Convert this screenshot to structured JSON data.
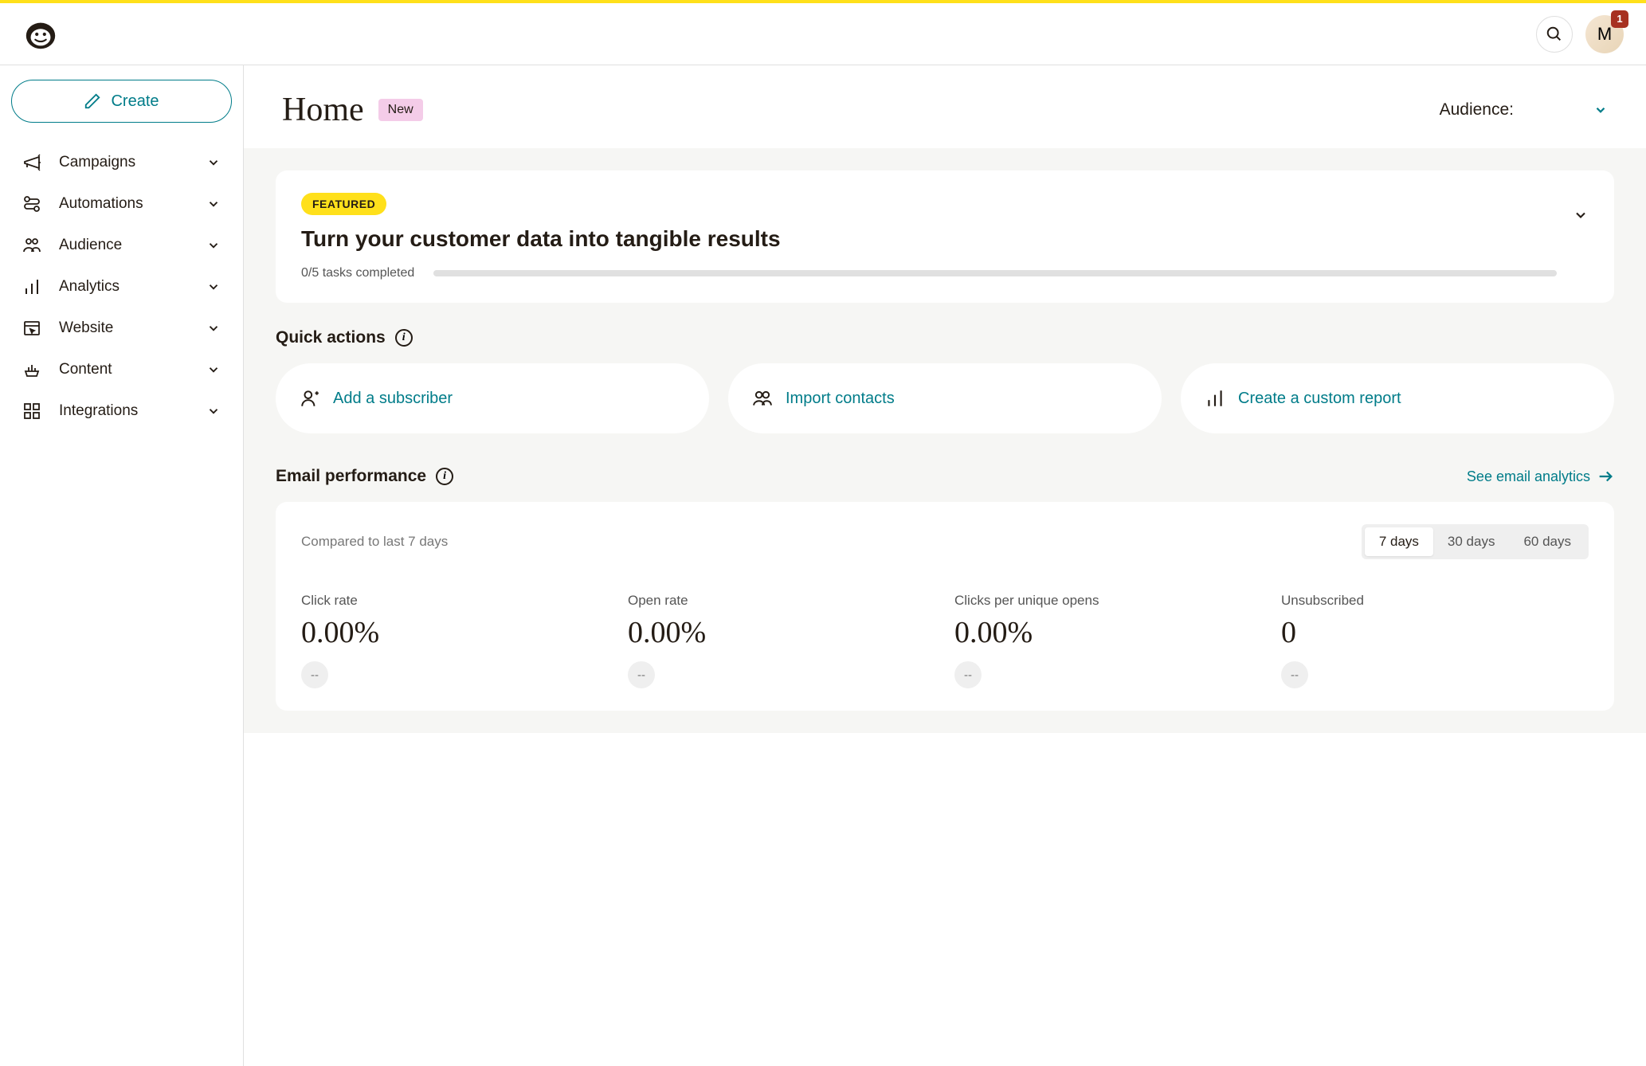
{
  "header": {
    "avatar_initial": "M",
    "badge_count": "1"
  },
  "sidebar": {
    "create_label": "Create",
    "items": [
      {
        "label": "Campaigns"
      },
      {
        "label": "Automations"
      },
      {
        "label": "Audience"
      },
      {
        "label": "Analytics"
      },
      {
        "label": "Website"
      },
      {
        "label": "Content"
      },
      {
        "label": "Integrations"
      }
    ]
  },
  "page": {
    "title": "Home",
    "new_badge": "New",
    "audience_label": "Audience:"
  },
  "featured": {
    "badge": "FEATURED",
    "title": "Turn your customer data into tangible results",
    "progress_text": "0/5 tasks completed"
  },
  "quick_actions": {
    "title": "Quick actions",
    "items": [
      {
        "label": "Add a subscriber"
      },
      {
        "label": "Import contacts"
      },
      {
        "label": "Create a custom report"
      }
    ]
  },
  "email_perf": {
    "title": "Email performance",
    "link": "See email analytics",
    "compare_text": "Compared to last 7 days",
    "segments": [
      "7 days",
      "30 days",
      "60 days"
    ],
    "metrics": [
      {
        "label": "Click rate",
        "value": "0.00%",
        "delta": "--"
      },
      {
        "label": "Open rate",
        "value": "0.00%",
        "delta": "--"
      },
      {
        "label": "Clicks per unique opens",
        "value": "0.00%",
        "delta": "--"
      },
      {
        "label": "Unsubscribed",
        "value": "0",
        "delta": "--"
      }
    ]
  }
}
